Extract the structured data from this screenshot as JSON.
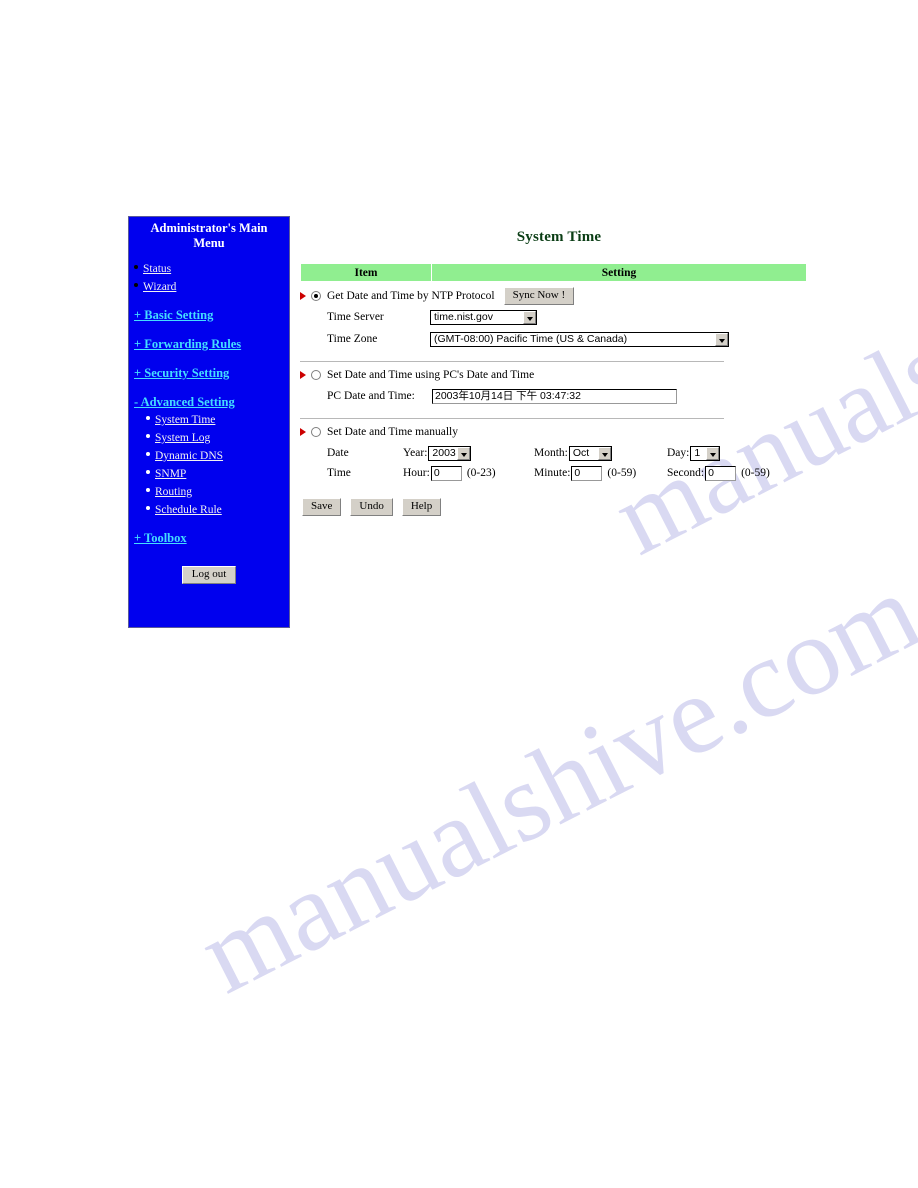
{
  "watermark": {
    "line1": "manualshive.com",
    "line2": "manualshive.com"
  },
  "sidebar": {
    "title": "Administrator's Main Menu",
    "top_links": [
      {
        "label": "Status",
        "icon": "bullet-icon"
      },
      {
        "label": "Wizard",
        "icon": "bullet-icon"
      }
    ],
    "sections": [
      {
        "label": "+ Basic Setting"
      },
      {
        "label": "+ Forwarding Rules"
      },
      {
        "label": "+ Security Setting"
      },
      {
        "label": "- Advanced Setting"
      }
    ],
    "advanced_items": [
      {
        "label": "System Time"
      },
      {
        "label": "System Log"
      },
      {
        "label": "Dynamic DNS"
      },
      {
        "label": "SNMP"
      },
      {
        "label": "Routing"
      },
      {
        "label": "Schedule Rule"
      }
    ],
    "toolbox": {
      "label": "+ Toolbox"
    },
    "logout": {
      "label": "Log out"
    },
    "colors": {
      "background": "#0000ee",
      "link": "#f2f2f2",
      "section_link": "#44ddff",
      "title": "#ffffff"
    }
  },
  "main": {
    "page_title": "System Time",
    "table_headers": {
      "item": "Item",
      "setting": "Setting"
    },
    "header_color": "#90ee90",
    "options": {
      "ntp": {
        "label": "Get Date and Time by NTP Protocol",
        "selected": true,
        "sync_button": "Sync Now !",
        "time_server": {
          "label": "Time Server",
          "value": "time.nist.gov"
        },
        "time_zone": {
          "label": "Time Zone",
          "value": "(GMT-08:00) Pacific Time (US & Canada)"
        }
      },
      "pc": {
        "label": "Set Date and Time using PC's Date and Time",
        "selected": false,
        "pc_datetime": {
          "label": "PC Date and Time:",
          "value": "2003年10月14日 下午 03:47:32"
        }
      },
      "manual": {
        "label": "Set Date and Time manually",
        "selected": false,
        "date_label": "Date",
        "time_label": "Time",
        "year": {
          "label": "Year:",
          "value": "2003"
        },
        "month": {
          "label": "Month:",
          "value": "Oct"
        },
        "day": {
          "label": "Day:",
          "value": "1"
        },
        "hour": {
          "label": "Hour:",
          "value": "0",
          "range": "(0-23)"
        },
        "minute": {
          "label": "Minute:",
          "value": "0",
          "range": "(0-59)"
        },
        "second": {
          "label": "Second:",
          "value": "0",
          "range": "(0-59)"
        }
      }
    },
    "buttons": {
      "save": "Save",
      "undo": "Undo",
      "help": "Help"
    }
  }
}
